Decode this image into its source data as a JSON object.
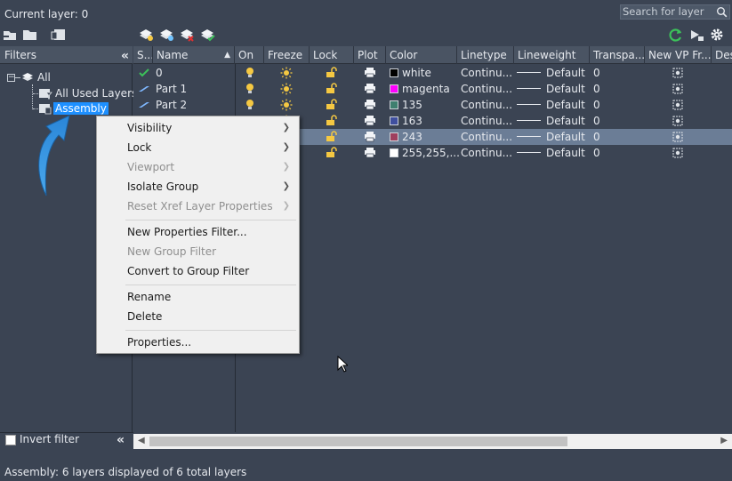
{
  "header": {
    "current_layer": "Current layer: 0",
    "search_placeholder": "Search for layer"
  },
  "filters": {
    "title": "Filters",
    "collapse_glyph": "«",
    "tree": {
      "all": "All",
      "all_used": "All Used Layers",
      "assembly": "Assembly"
    }
  },
  "columns": [
    {
      "label": "S..."
    },
    {
      "label": "Name"
    },
    {
      "label": "On"
    },
    {
      "label": "Freeze"
    },
    {
      "label": "Lock"
    },
    {
      "label": "Plot"
    },
    {
      "label": "Color"
    },
    {
      "label": "Linetype"
    },
    {
      "label": "Lineweight"
    },
    {
      "label": "Transpa..."
    },
    {
      "label": "New VP Fr..."
    },
    {
      "label": "Des"
    }
  ],
  "rows": [
    {
      "name": "0",
      "color_name": "white",
      "color_hex": "#000000",
      "linetype": "Continu...",
      "lineweight": "Default",
      "transparency": "0",
      "current": true,
      "selected": false
    },
    {
      "name": "Part 1",
      "color_name": "magenta",
      "color_hex": "#ff00ff",
      "linetype": "Continu...",
      "lineweight": "Default",
      "transparency": "0",
      "current": false,
      "selected": false
    },
    {
      "name": "Part 2",
      "color_name": "135",
      "color_hex": "#3f7f6f",
      "linetype": "Continu...",
      "lineweight": "Default",
      "transparency": "0",
      "current": false,
      "selected": false
    },
    {
      "name": "",
      "color_name": "163",
      "color_hex": "#3f4f9f",
      "linetype": "Continu...",
      "lineweight": "Default",
      "transparency": "0",
      "current": false,
      "selected": false
    },
    {
      "name": "",
      "color_name": "243",
      "color_hex": "#9f3f5f",
      "linetype": "Continu...",
      "lineweight": "Default",
      "transparency": "0",
      "current": false,
      "selected": true
    },
    {
      "name": "",
      "color_name": "255,255,...",
      "color_hex": "#ffffff",
      "linetype": "Continu...",
      "lineweight": "Default",
      "transparency": "0",
      "current": false,
      "selected": false
    }
  ],
  "context_menu": {
    "visibility": "Visibility",
    "lock": "Lock",
    "viewport": "Viewport",
    "isolate_group": "Isolate Group",
    "reset_xref": "Reset Xref Layer Properties",
    "new_properties_filter": "New Properties Filter...",
    "new_group_filter": "New Group Filter",
    "convert_to_group": "Convert to Group Filter",
    "rename": "Rename",
    "delete": "Delete",
    "properties": "Properties..."
  },
  "footer": {
    "invert_filter": "Invert filter",
    "status": "Assembly: 6 layers displayed of 6 total layers"
  },
  "colors": {
    "background": "#3b4453",
    "header": "#4a5463",
    "selection": "#6b7d96",
    "tree_highlight": "#1e90ff",
    "bulb": "#f5c842",
    "accent_arrow": "#2a9be0"
  }
}
